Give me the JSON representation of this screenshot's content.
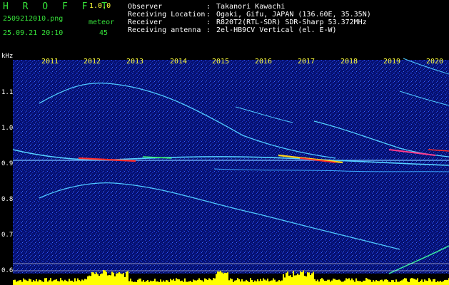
{
  "header": {
    "title": "H R O F F T",
    "version": "1.0.0",
    "filename": "2509212010.png",
    "meteor_label": "meteor",
    "timestamp": "25.09.21 20:10",
    "meteor_count": "45"
  },
  "info": [
    {
      "key": "Observer",
      "value": "Takanori Kawachi"
    },
    {
      "key": "Receiving Location",
      "value": "Ogaki, Gifu, JAPAN (136.60E, 35.35N)"
    },
    {
      "key": "Receiver",
      "value": "R820T2(RTL-SDR) SDR-Sharp 53.372MHz"
    },
    {
      "key": "Receiving antenna",
      "value": "2el-HB9CV Vertical (el. E-W)"
    }
  ],
  "info_separator": ":",
  "axis": {
    "unit": "kHz",
    "frequency_labels": [
      "1.1",
      "1.0",
      "0.9",
      "0.8",
      "0.7",
      "0.6"
    ],
    "year_labels": [
      "2011",
      "2012",
      "2013",
      "2014",
      "2015",
      "2016",
      "2017",
      "2018",
      "2019",
      "2020"
    ]
  },
  "colors": {
    "header_green": "#36e23a",
    "label_yellow": "#ffff3a",
    "text_white": "#ffffff",
    "background_noise": "#0a1a8a",
    "trace_cyan": "#4fc7ff",
    "hot_red": "#ff2a2a"
  }
}
